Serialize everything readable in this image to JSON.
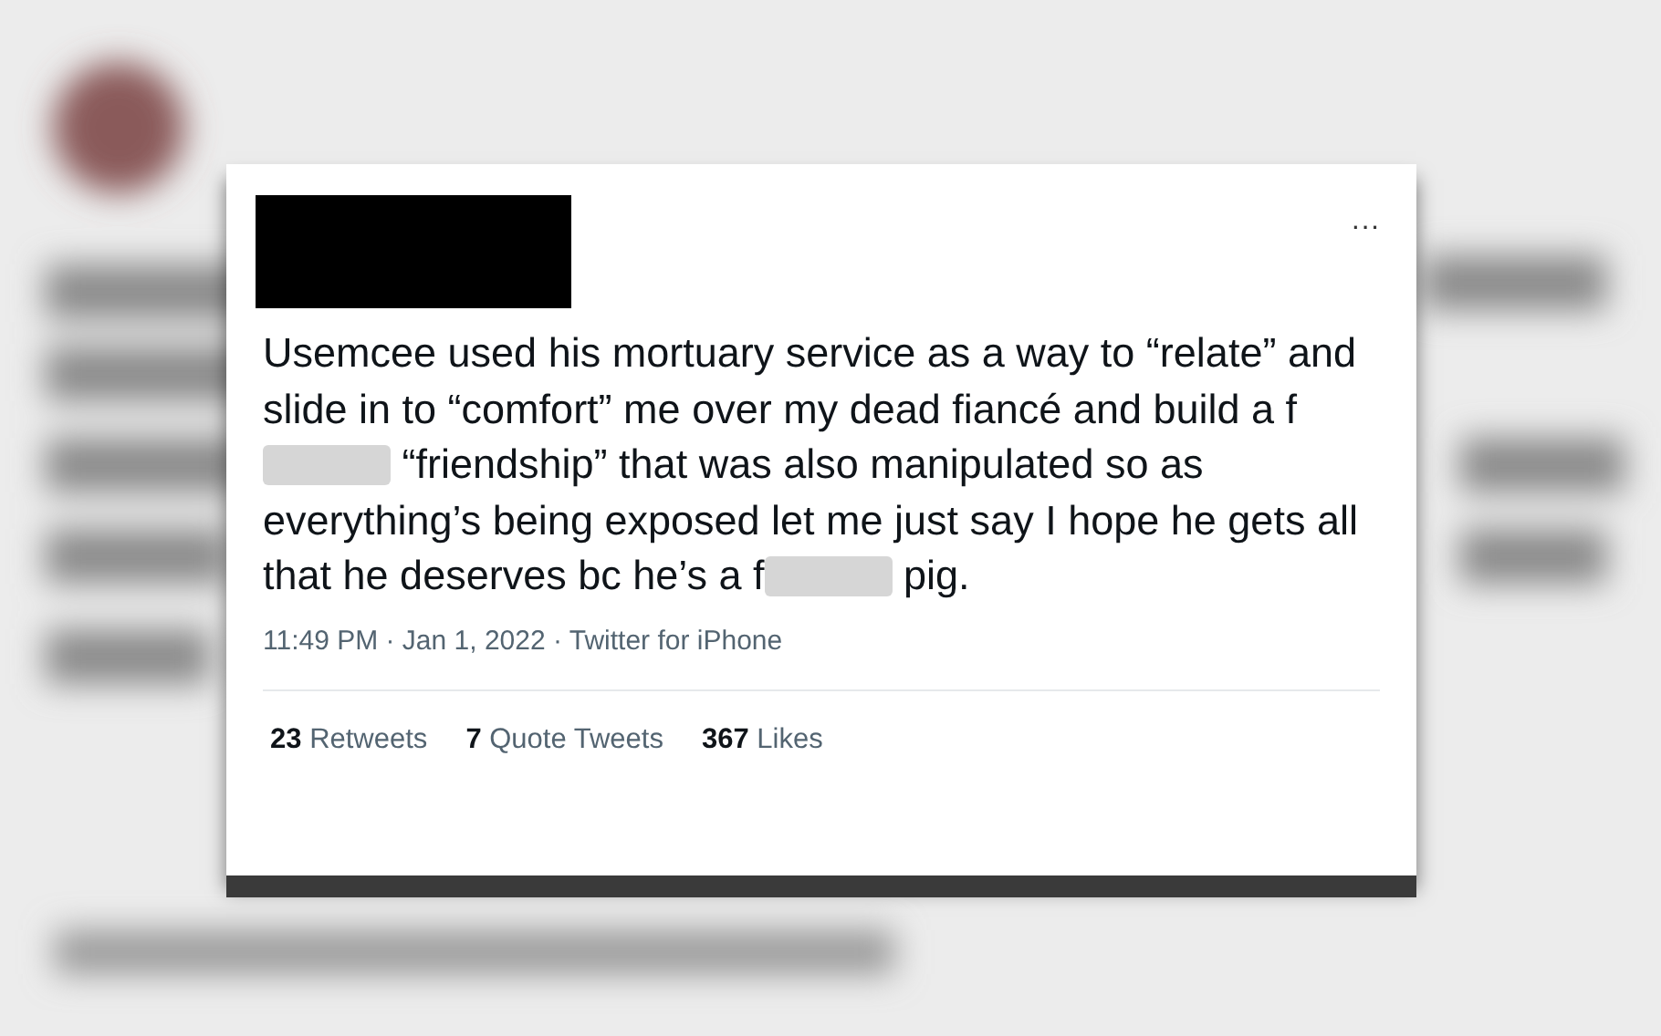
{
  "tweet": {
    "more": "···",
    "body": [
      {
        "kind": "text",
        "text": "Usemcee used his mortuary service as a way to “relate” and slide in to “comfort” me over my dead fiancé and build a f"
      },
      {
        "kind": "censor"
      },
      {
        "kind": "text",
        "text": " “friendship” that was also manipulated so as everything’s being exposed let me just say I hope he gets all that he deserves bc he’s a f"
      },
      {
        "kind": "censor"
      },
      {
        "kind": "text",
        "text": " pig."
      }
    ],
    "meta": "11:49 PM · Jan 1, 2022 · Twitter for iPhone",
    "stats": [
      {
        "count": "23",
        "label": "Retweets"
      },
      {
        "count": "7",
        "label": "Quote Tweets"
      },
      {
        "count": "367",
        "label": "Likes"
      }
    ]
  }
}
